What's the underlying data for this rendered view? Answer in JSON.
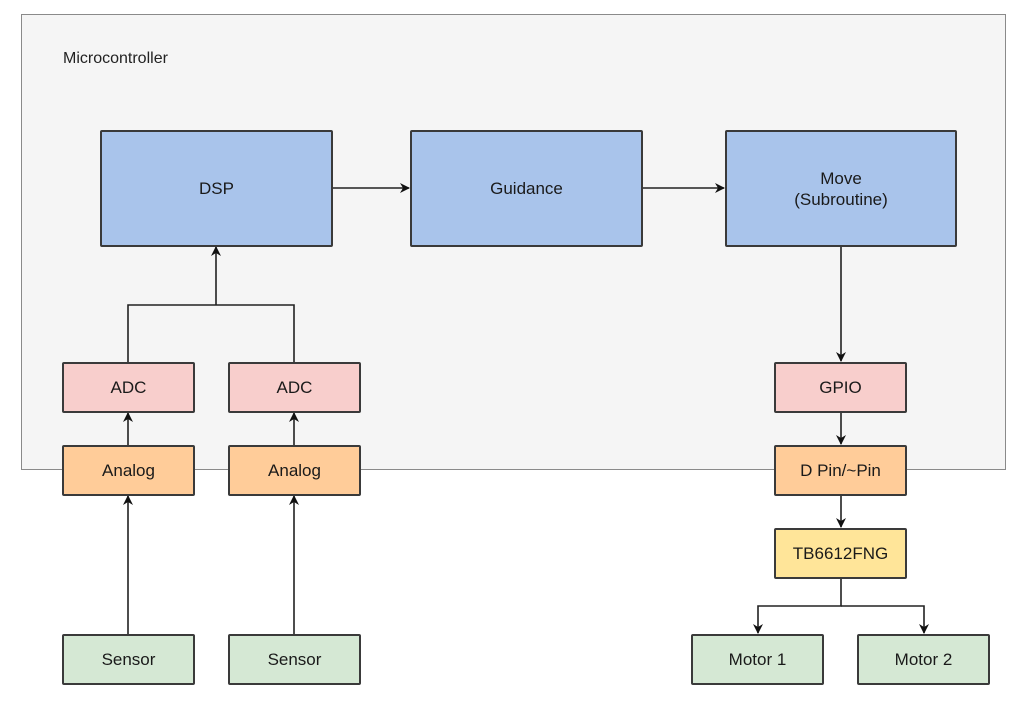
{
  "diagram": {
    "container": {
      "label": "Microcontroller"
    },
    "nodes": {
      "dsp": {
        "label": "DSP",
        "color": "#a9c4eb"
      },
      "guidance": {
        "label": "Guidance",
        "color": "#a9c4eb"
      },
      "move": {
        "label": "Move\n(Subroutine)",
        "color": "#a9c4eb"
      },
      "adc1": {
        "label": "ADC",
        "color": "#f8cecc"
      },
      "adc2": {
        "label": "ADC",
        "color": "#f8cecc"
      },
      "gpio": {
        "label": "GPIO",
        "color": "#f8cecc"
      },
      "analog1": {
        "label": "Analog",
        "color": "#ffcc99"
      },
      "analog2": {
        "label": "Analog",
        "color": "#ffcc99"
      },
      "dpin": {
        "label": "D Pin/~Pin",
        "color": "#ffcc99"
      },
      "driver": {
        "label": "TB6612FNG",
        "color": "#ffe599"
      },
      "sensor1": {
        "label": "Sensor",
        "color": "#d5e8d4"
      },
      "sensor2": {
        "label": "Sensor",
        "color": "#d5e8d4"
      },
      "motor1": {
        "label": "Motor 1",
        "color": "#d5e8d4"
      },
      "motor2": {
        "label": "Motor 2",
        "color": "#d5e8d4"
      }
    },
    "edges": [
      {
        "from": "dsp",
        "to": "guidance"
      },
      {
        "from": "guidance",
        "to": "move"
      },
      {
        "from": "adc1",
        "to": "dsp"
      },
      {
        "from": "adc2",
        "to": "dsp"
      },
      {
        "from": "analog1",
        "to": "adc1"
      },
      {
        "from": "analog2",
        "to": "adc2"
      },
      {
        "from": "sensor1",
        "to": "analog1"
      },
      {
        "from": "sensor2",
        "to": "analog2"
      },
      {
        "from": "move",
        "to": "gpio"
      },
      {
        "from": "gpio",
        "to": "dpin"
      },
      {
        "from": "dpin",
        "to": "driver"
      },
      {
        "from": "driver",
        "to": "motor1"
      },
      {
        "from": "driver",
        "to": "motor2"
      }
    ]
  }
}
